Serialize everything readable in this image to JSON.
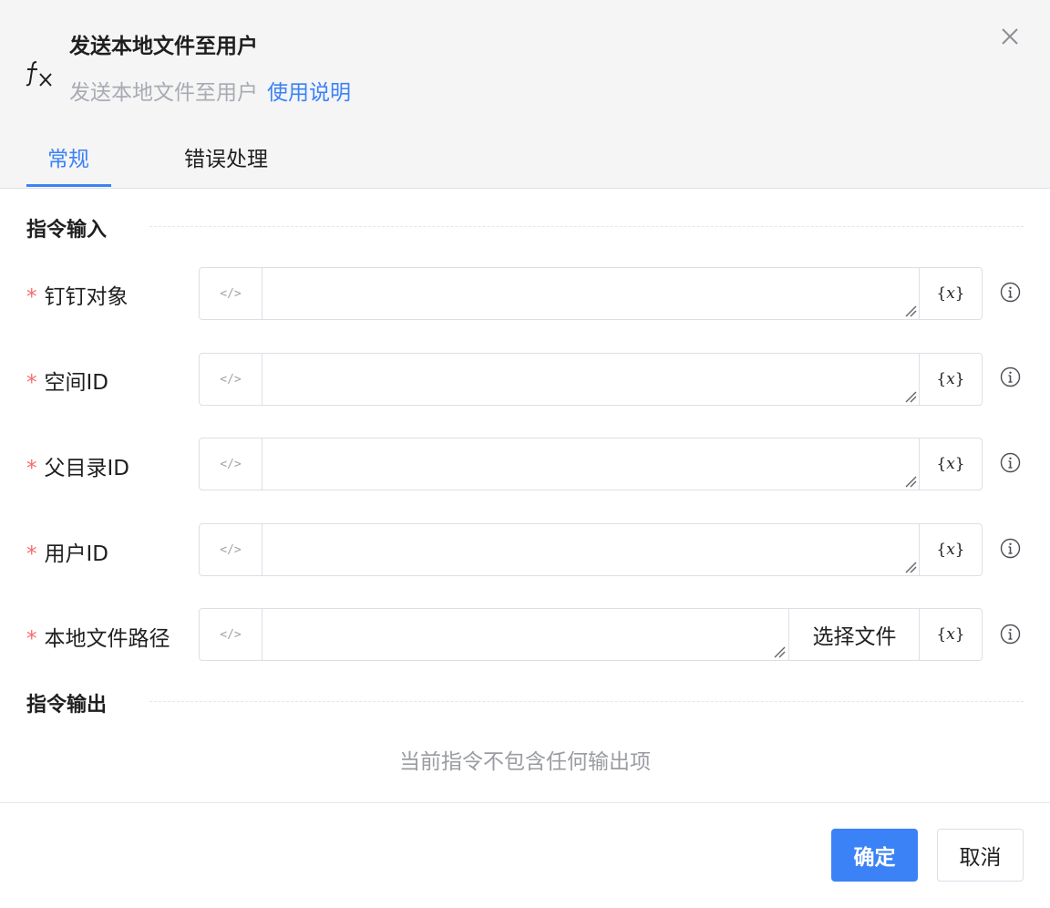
{
  "dialog": {
    "title": "发送本地文件至用户",
    "subtitle": "发送本地文件至用户",
    "help_link": "使用说明"
  },
  "tabs": [
    {
      "label": "常规",
      "active": true
    },
    {
      "label": "错误处理",
      "active": false
    }
  ],
  "input_section": {
    "title": "指令输入",
    "fields": [
      {
        "label": "钉钉对象",
        "required": "*",
        "value": ""
      },
      {
        "label": "空间ID",
        "required": "*",
        "value": ""
      },
      {
        "label": "父目录ID",
        "required": "*",
        "value": ""
      },
      {
        "label": "用户ID",
        "required": "*",
        "value": ""
      },
      {
        "label": "本地文件路径",
        "required": "*",
        "value": "",
        "select_file_label": "选择文件"
      }
    ],
    "code_toggle_glyph": "</>",
    "variable_glyph_open": "{",
    "variable_glyph_var": "x",
    "variable_glyph_close": "}"
  },
  "output_section": {
    "title": "指令输出",
    "empty_text": "当前指令不包含任何输出项"
  },
  "footer": {
    "confirm_label": "确定",
    "cancel_label": "取消"
  },
  "colors": {
    "accent": "#3b82f6",
    "required": "#f56c6c",
    "header_bg": "#f5f5f6"
  },
  "icons": {
    "function": "fx-icon",
    "close": "close-icon",
    "info": "info-icon",
    "resize": "resize-grip-icon"
  }
}
